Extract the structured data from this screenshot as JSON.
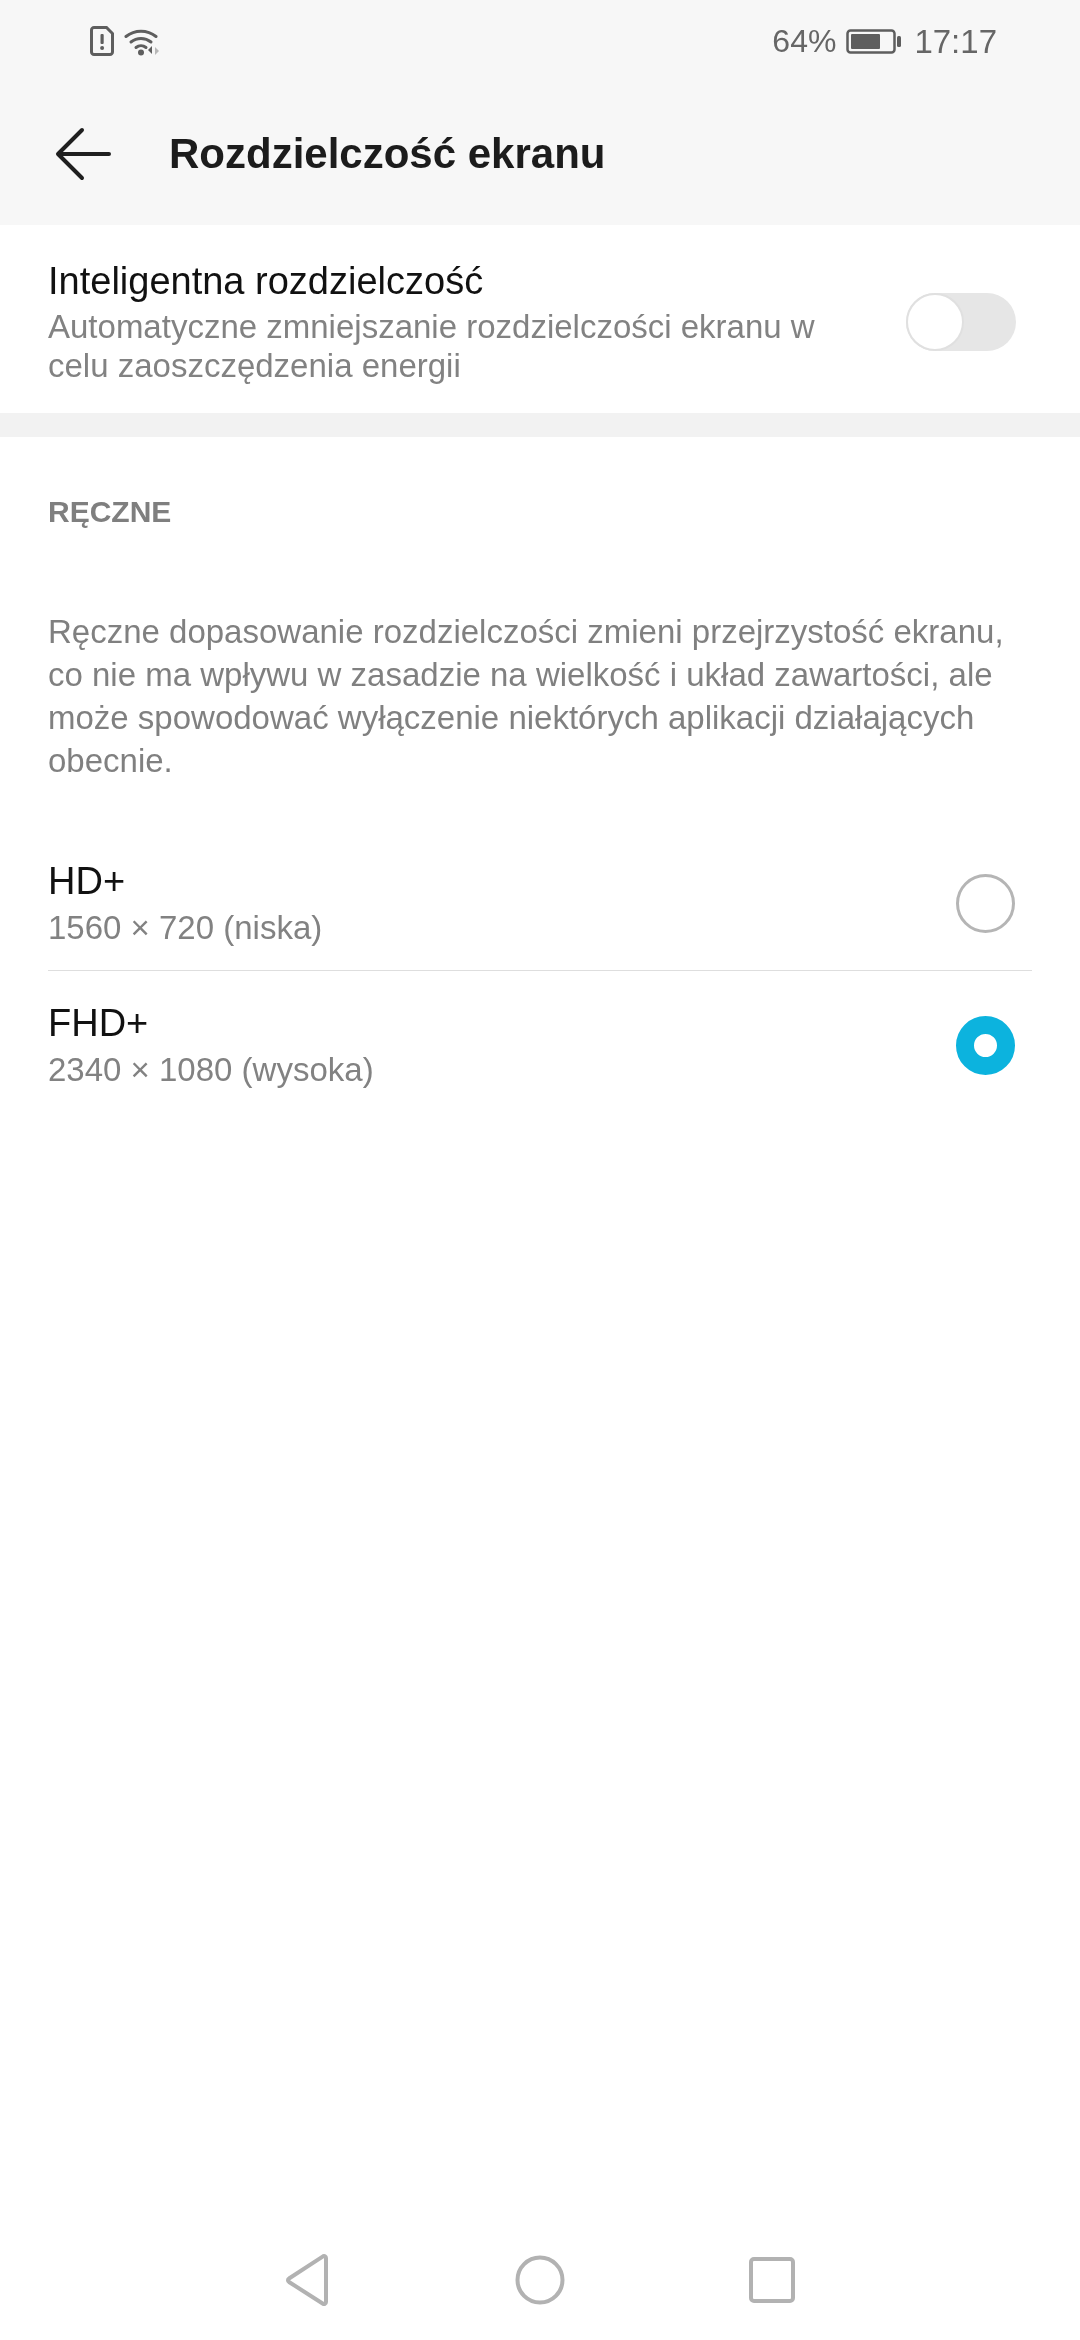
{
  "status_bar": {
    "battery_percent": "64%",
    "time": "17:17"
  },
  "app_bar": {
    "title": "Rozdzielczość ekranu"
  },
  "smart_resolution": {
    "title": "Inteligentna rozdzielczość",
    "description": "Automatyczne zmniejszanie rozdzielczości ekranu w celu zaoszczędzenia energii",
    "on": false
  },
  "manual_section": {
    "header": "RĘCZNE",
    "description": "Ręczne dopasowanie rozdzielczości zmieni przejrzystość ekranu, co nie ma wpływu w zasadzie na wielkość i układ zawartości, ale może spowodować wyłączenie niektórych aplikacji działających obecnie."
  },
  "options": [
    {
      "title": "HD+",
      "subtitle": "1560 × 720 (niska)",
      "selected": false
    },
    {
      "title": "FHD+",
      "subtitle": "2340 × 1080 (wysoka)",
      "selected": true
    }
  ]
}
